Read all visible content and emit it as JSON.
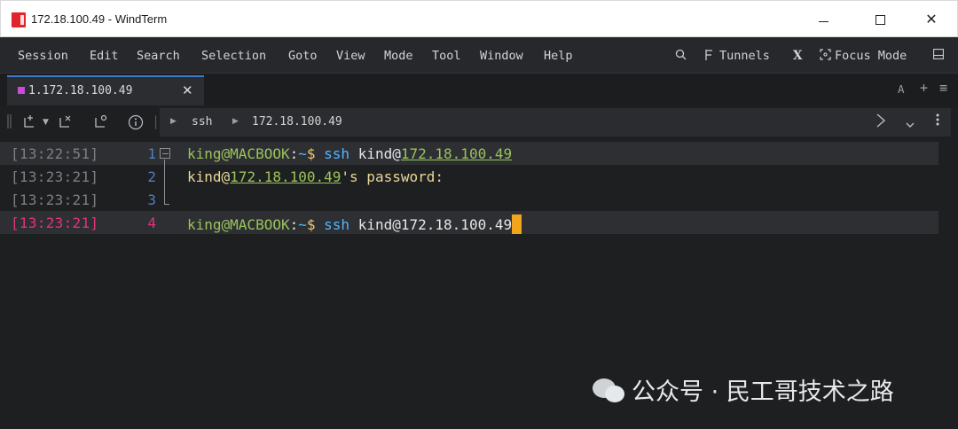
{
  "window": {
    "title": "172.18.100.49 - WindTerm",
    "min_glyph": "—",
    "close_glyph": "✕"
  },
  "menu": {
    "items": [
      "Session",
      "Edit",
      "Search",
      "Selection",
      "Goto",
      "View",
      "Mode",
      "Tool",
      "Window",
      "Help"
    ],
    "tunnels": "Tunnels",
    "x_label": "X",
    "focus_mode": "Focus Mode"
  },
  "tabs": {
    "active_label": "1.172.18.100.49",
    "right": {
      "a": "A",
      "plus": "+",
      "menu": "≡"
    }
  },
  "breadcrumb": {
    "items": [
      "ssh",
      "172.18.100.49"
    ]
  },
  "terminal": {
    "lines": [
      {
        "time": "[13:22:51]",
        "num": "1",
        "user": "king@MACBOOK",
        "sep": ":",
        "tilde": "~",
        "dollar": "$",
        "cmd": "ssh",
        "arg_user": "kind@",
        "ip": "172.18.100.49"
      },
      {
        "time": "[13:23:21]",
        "num": "2",
        "arg_user": "kind@",
        "ip": "172.18.100.49",
        "suffix": "'s password:"
      },
      {
        "time": "[13:23:21]",
        "num": "3"
      },
      {
        "time": "[13:23:21]",
        "num": "4",
        "user": "king@MACBOOK",
        "sep": ":",
        "tilde": "~",
        "dollar": "$",
        "cmd": "ssh",
        "arg_user": "kind@",
        "ip": "172.18.100.49"
      }
    ]
  },
  "watermark": {
    "text": "公众号 · 民工哥技术之路"
  },
  "colors": {
    "background": "#1e1f21",
    "accent_cursor": "#f1a51c",
    "active_line": "#e0347a",
    "user_green": "#9bc35a",
    "cmd_blue": "#4fb7ff"
  }
}
